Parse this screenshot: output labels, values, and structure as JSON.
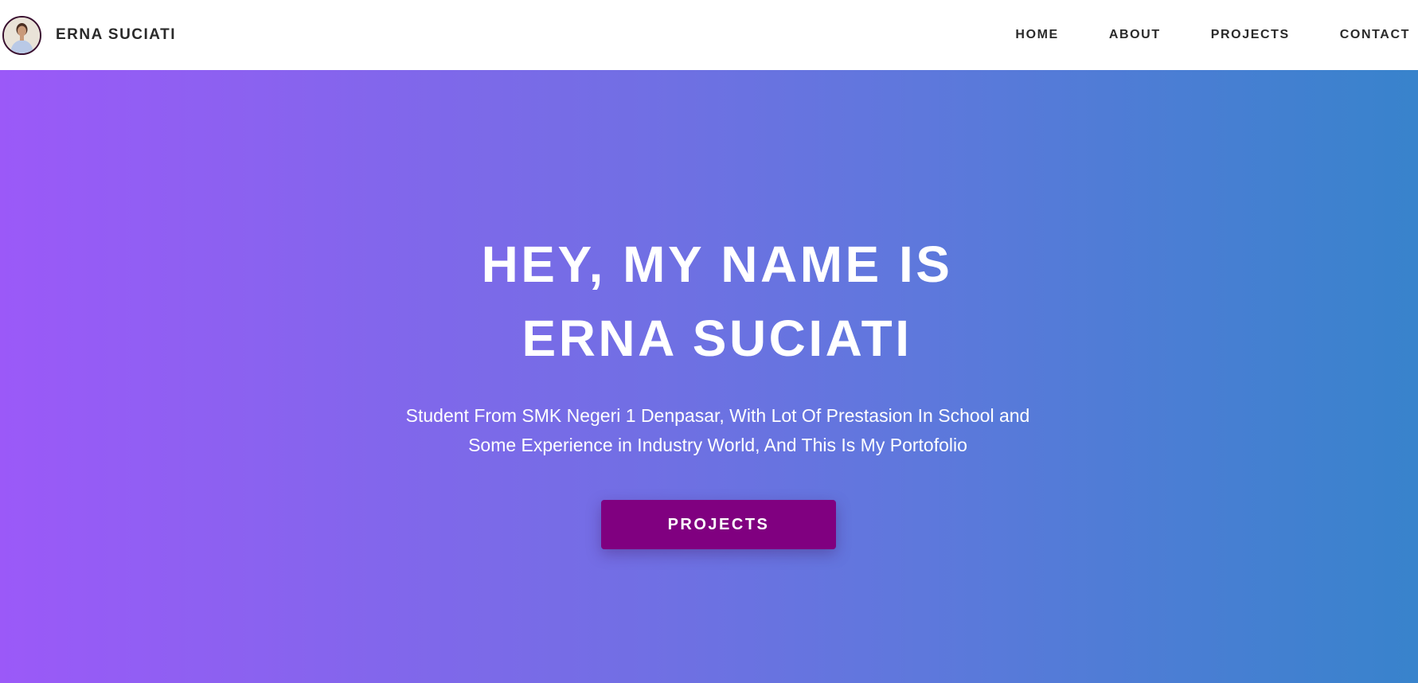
{
  "header": {
    "brand_name": "ERNA SUCIATI",
    "nav": [
      "HOME",
      "ABOUT",
      "PROJECTS",
      "CONTACT"
    ]
  },
  "hero": {
    "title_line1": "HEY, MY NAME IS",
    "title_line2": "ERNA SUCIATI",
    "desc_line1": "Student From SMK Negeri 1 Denpasar, With Lot Of Prestasion In School and",
    "desc_line2": "Some Experience in Industry World, And This Is My Portofolio",
    "button_label": "PROJECTS"
  },
  "colors": {
    "gradient_start": "#9b59f8",
    "gradient_end": "#3883cc",
    "button_bg": "#800080",
    "header_bg": "#ffffff",
    "nav_text": "#2a2a2a"
  }
}
